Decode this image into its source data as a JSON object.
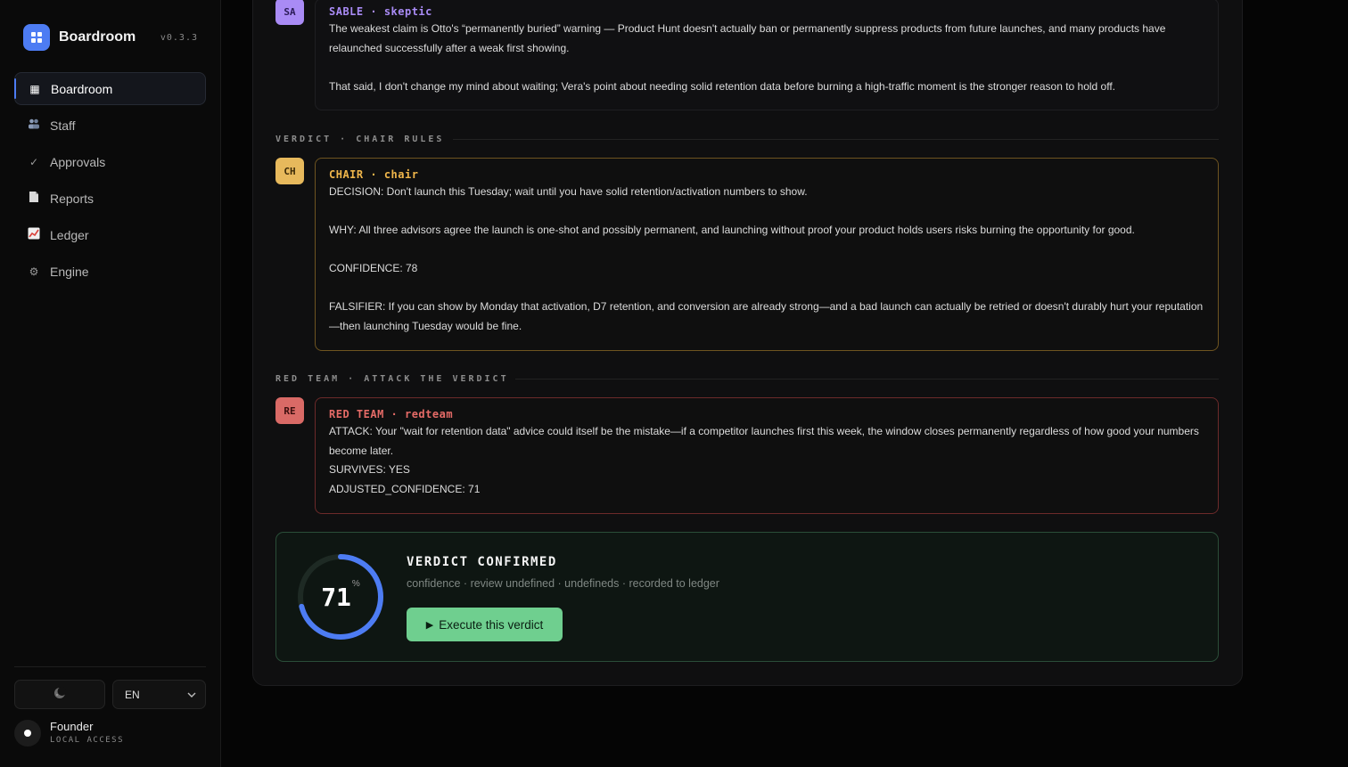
{
  "app": {
    "name": "Boardroom",
    "version": "v0.3.3"
  },
  "sidebar": {
    "items": [
      {
        "label": "Boardroom",
        "icon": "grid-icon"
      },
      {
        "label": "Staff",
        "icon": "people-icon"
      },
      {
        "label": "Approvals",
        "icon": "check-icon"
      },
      {
        "label": "Reports",
        "icon": "document-icon"
      },
      {
        "label": "Ledger",
        "icon": "chart-icon"
      },
      {
        "label": "Engine",
        "icon": "gear-icon"
      }
    ],
    "active_index": 0,
    "language": "EN",
    "user": {
      "name": "Founder",
      "role": "LOCAL ACCESS"
    }
  },
  "messages": {
    "sable": {
      "initials": "SA",
      "name": "SABLE",
      "role": "skeptic",
      "paragraphs": [
        "The weakest claim is Otto's “permanently buried” warning — Product Hunt doesn't actually ban or permanently suppress products from future launches, and many products have relaunched successfully after a weak first showing.",
        "That said, I don't change my mind about waiting; Vera's point about needing solid retention data before burning a high-traffic moment is the stronger reason to hold off."
      ]
    },
    "verdict_section": "VERDICT · CHAIR RULES",
    "chair": {
      "initials": "CH",
      "name": "CHAIR",
      "role": "chair",
      "decision": "DECISION: Don't launch this Tuesday; wait until you have solid retention/activation numbers to show.",
      "why": "WHY: All three advisors agree the launch is one-shot and possibly permanent, and launching without proof your product holds users risks burning the opportunity for good.",
      "confidence": "CONFIDENCE: 78",
      "falsifier": "FALSIFIER: If you can show by Monday that activation, D7 retention, and conversion are already strong—and a bad launch can actually be retried or doesn't durably hurt your reputation—then launching Tuesday would be fine."
    },
    "red_section": "RED TEAM · ATTACK THE VERDICT",
    "redteam": {
      "initials": "RE",
      "name": "RED TEAM",
      "role": "redteam",
      "attack": "ATTACK: Your \"wait for retention data\" advice could itself be the mistake—if a competitor launches first this week, the window closes permanently regardless of how good your numbers become later.",
      "survives": "SURVIVES: YES",
      "adjusted": "ADJUSTED_CONFIDENCE: 71"
    }
  },
  "verdict": {
    "confidence": 71,
    "confidence_text": "71",
    "percent_sign": "%",
    "title": "VERDICT CONFIRMED",
    "subtitle": "confidence · review undefined · undefineds · recorded to ledger",
    "button_label": "Execute this verdict",
    "ring_color": "#4d7cf3"
  }
}
